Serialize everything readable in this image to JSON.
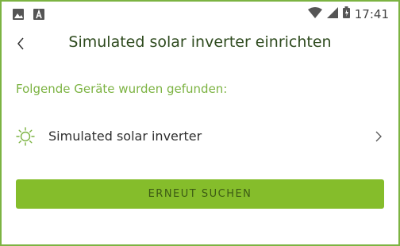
{
  "status_bar": {
    "time": "17:41",
    "left_icons": [
      "image-icon",
      "a-icon"
    ],
    "right_icons": [
      "wifi-icon",
      "cell-signal-icon",
      "battery-icon"
    ]
  },
  "app_bar": {
    "back_icon": "chevron-left-icon",
    "title": "Simulated solar inverter einrichten"
  },
  "main": {
    "section_label": "Folgende Geräte wurden gefunden:",
    "devices": [
      {
        "icon": "sun-icon",
        "label": "Simulated solar inverter"
      }
    ],
    "search_again_label": "ERNEUT SUCHEN"
  },
  "colors": {
    "accent": "#7cb342",
    "button": "#85bd2b",
    "title_text": "#2e4a1e"
  }
}
